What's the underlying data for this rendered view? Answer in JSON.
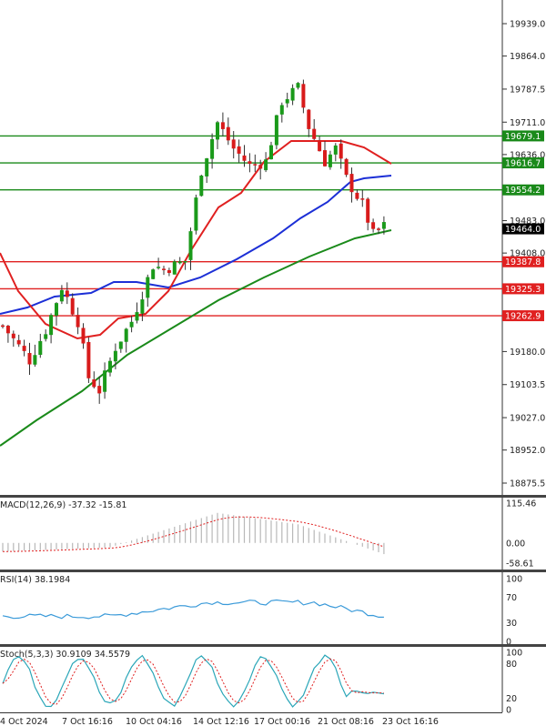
{
  "chart_data": [
    {
      "type": "candlestick",
      "ylim": [
        18840,
        19980
      ],
      "price_ticks": [
        "19939.0",
        "19864.0",
        "19787.5",
        "19711.0",
        "19636.0",
        "19483.0",
        "19408.0",
        "19180.0",
        "19103.5",
        "19027.0",
        "18952.0",
        "18875.5"
      ],
      "current_price": {
        "value": "19464.0",
        "color": "#000000"
      },
      "resistance_levels": [
        {
          "value": 19679.1,
          "label": "19679.1",
          "color": "#1a8a1a"
        },
        {
          "value": 19616.7,
          "label": "19616.7",
          "color": "#1a8a1a"
        },
        {
          "value": 19554.2,
          "label": "19554.2",
          "color": "#1a8a1a"
        }
      ],
      "support_levels": [
        {
          "value": 19387.8,
          "label": "19387.8",
          "color": "#e02020"
        },
        {
          "value": 19325.3,
          "label": "19325.3",
          "color": "#e02020"
        },
        {
          "value": 19262.9,
          "label": "19262.9",
          "color": "#e02020"
        }
      ],
      "x_labels": [
        "4 Oct 2024",
        "7 Oct 16:16",
        "10 Oct 04:16",
        "14 Oct 12:16",
        "17 Oct 00:16",
        "21 Oct 08:16",
        "23 Oct 16:16"
      ],
      "colors": {
        "up": "#1a9a1a",
        "down": "#d81b1b",
        "ma_fast": "#e02020",
        "ma_mid": "#1c2fd6",
        "ma_slow": "#1a8a1a"
      }
    },
    {
      "type": "bar",
      "name": "MACD",
      "label": "MACD(12,26,9) -37.32 -15.81",
      "ticks": [
        "115.46",
        "0.00",
        "-58.61"
      ],
      "ylim": [
        -58.61,
        115.46
      ],
      "colors": {
        "hist": "#b8b8b8",
        "signal": "#e02020"
      }
    },
    {
      "type": "line",
      "name": "RSI",
      "label": "RSI(14) 38.1984",
      "ticks": [
        "100",
        "70",
        "30",
        "0"
      ],
      "ylim": [
        0,
        100
      ],
      "colors": {
        "line": "#3a9ad9"
      }
    },
    {
      "type": "line",
      "name": "Stoch",
      "label": "Stoch(5,3,3) 30.9109 34.5579",
      "ticks": [
        "100",
        "80",
        "20",
        "0"
      ],
      "ylim": [
        0,
        100
      ],
      "colors": {
        "k": "#2aa6b8",
        "d": "#e02020"
      }
    }
  ]
}
